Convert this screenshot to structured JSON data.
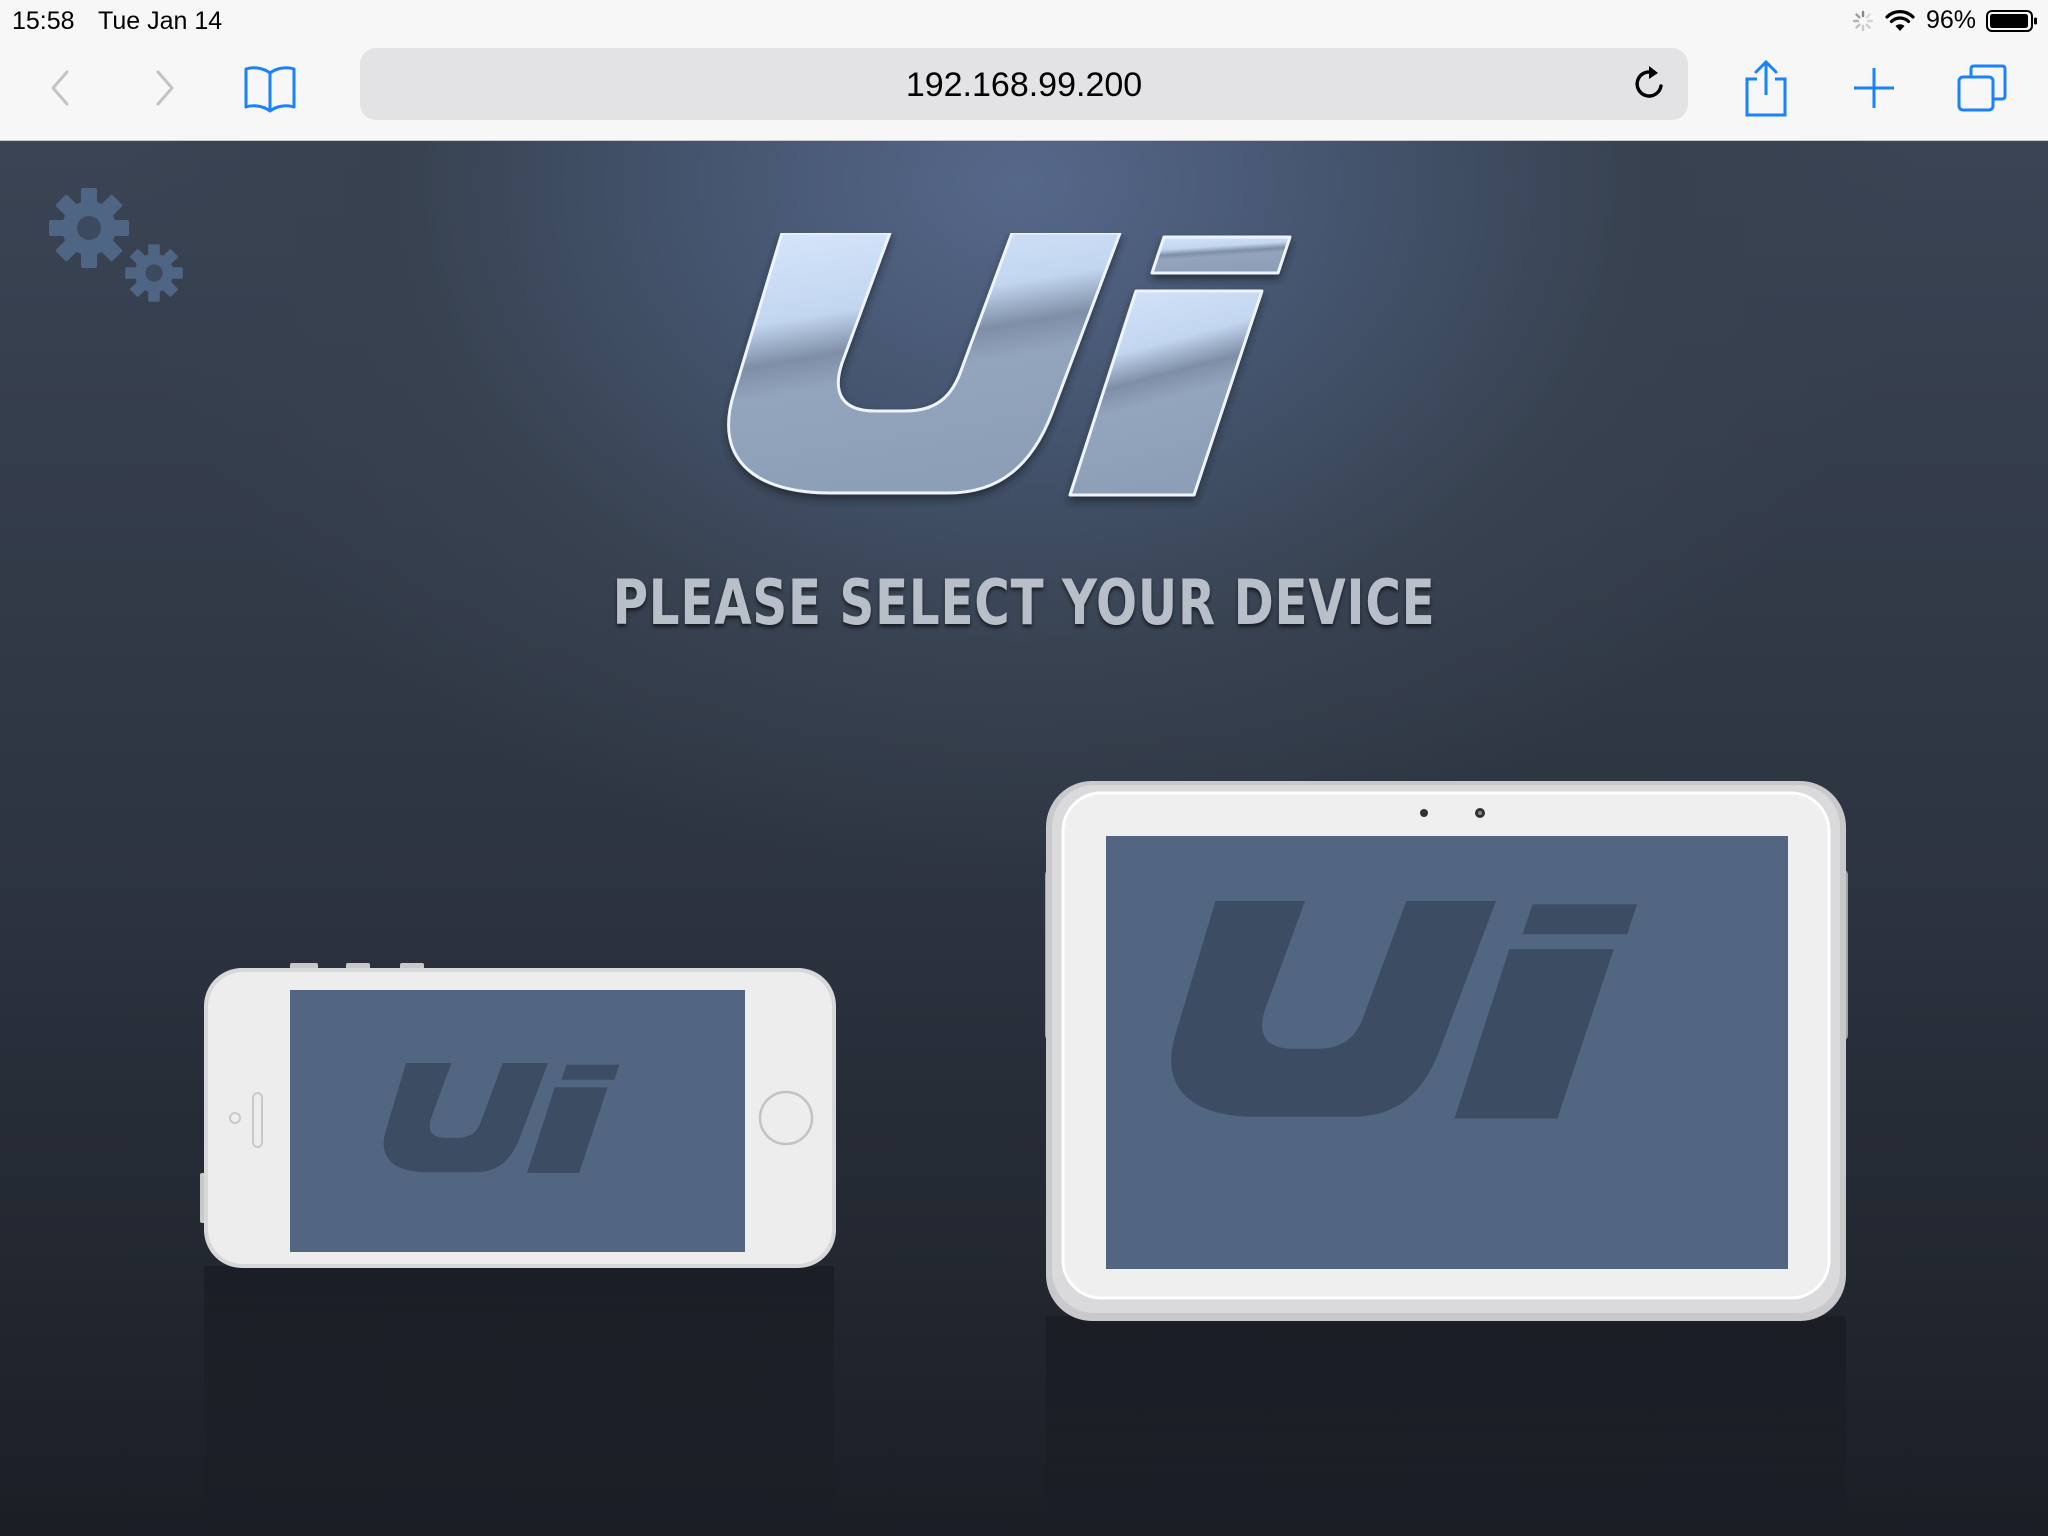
{
  "status_bar": {
    "time": "15:58",
    "date": "Tue Jan 14",
    "battery": "96%"
  },
  "browser": {
    "url": "192.168.99.200",
    "accent_color": "#1a82fb"
  },
  "page": {
    "logo_text": "Ui",
    "prompt": "PLEASE SELECT YOUR DEVICE",
    "devices": [
      "phone",
      "tablet"
    ]
  }
}
